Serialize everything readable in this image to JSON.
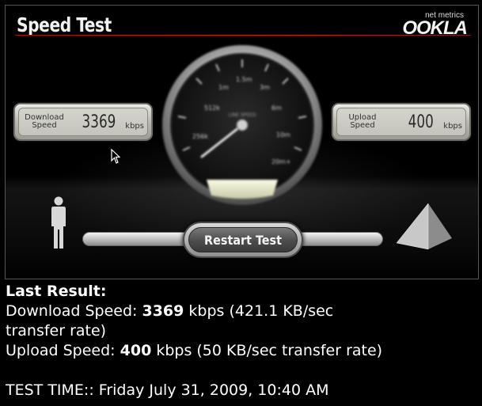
{
  "header": {
    "title": "Speed Test",
    "brand_tagline": "net metrics",
    "brand_name": "OOKLA"
  },
  "download_pod": {
    "label_line1": "Download",
    "label_line2": "Speed",
    "value": "3369",
    "unit": "kbps"
  },
  "upload_pod": {
    "label_line1": "Upload",
    "label_line2": "Speed",
    "value": "400",
    "unit": "kbps"
  },
  "gauge": {
    "center_label": "LINE SPEED",
    "tick_labels": [
      "512k",
      "1m",
      "1.5m",
      "3m",
      "6m",
      "10m",
      "20m+",
      "256k"
    ]
  },
  "restart_button": {
    "label": "Restart Test"
  },
  "results": {
    "heading": "Last Result:",
    "download_prefix": "Download Speed: ",
    "download_value": "3369",
    "download_suffix": " kbps (421.1 KB/sec",
    "download_line2": "transfer rate)",
    "upload_prefix": "Upload Speed: ",
    "upload_value": "400",
    "upload_suffix": " kbps (50 KB/sec transfer rate)",
    "test_time": "TEST TIME:: Friday July 31, 2009, 10:40 AM"
  },
  "colors": {
    "background": "#000000",
    "title_rule": "#c81a1a",
    "pod_face": "#c8c8c0",
    "text": "#ffffff"
  }
}
